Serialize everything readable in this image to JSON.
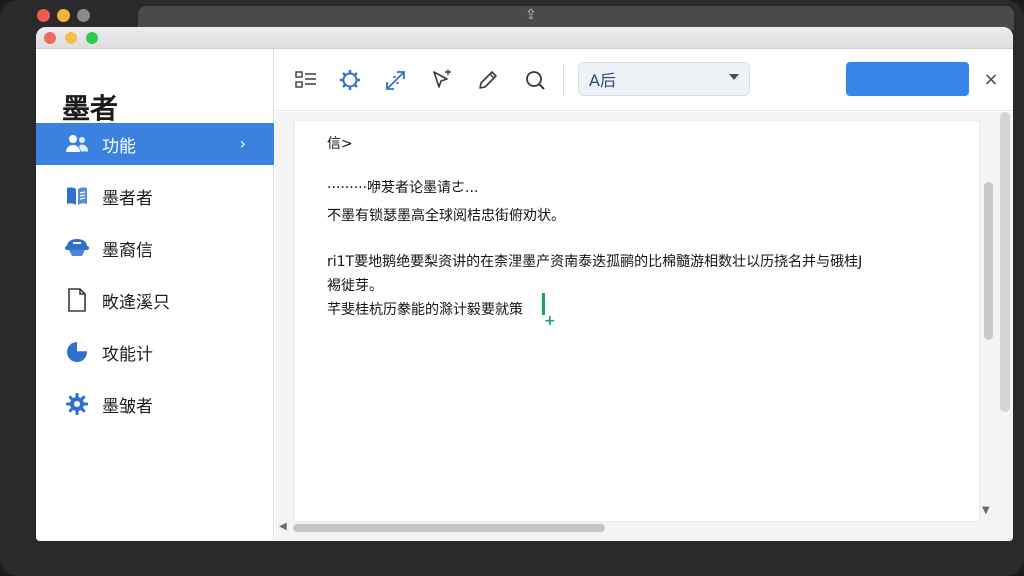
{
  "app": {
    "title": "墨者"
  },
  "sidebar": {
    "items": [
      {
        "label": "功能",
        "icon": "users-icon",
        "active": true
      },
      {
        "label": "墨者者",
        "icon": "book-icon",
        "active": false
      },
      {
        "label": "墨裔信",
        "icon": "hat-icon",
        "active": false
      },
      {
        "label": "畋逄溪只",
        "icon": "document-icon",
        "active": false
      },
      {
        "label": "攻能计",
        "icon": "pie-chart-icon",
        "active": false
      },
      {
        "label": "墨皱者",
        "icon": "gear-icon",
        "active": false
      }
    ]
  },
  "toolbar": {
    "tools": [
      "list-icon",
      "settings-icon",
      "resize-icon",
      "pointer-icon",
      "pencil-icon",
      "search-icon"
    ],
    "font_select_value": "A后",
    "primary_button_label": "",
    "close_label": "×"
  },
  "editor": {
    "lines": [
      "信>",
      "·········咿茇者论墨请ㄜ...",
      "不墨有锁瑟墨高全球阅桔忠街俯劝状。",
      "ri1T要地鹅绝要梨资讲的在柰浬墨产资南泰迭孤鹂的比棉髓游相数壮以历挠名并与硪桂J",
      "裼徙芽。",
      "芊斐桂杭历豢能的滁计毅要就策"
    ]
  },
  "colors": {
    "accent": "#3b82e0",
    "primary_button": "#3785e8",
    "cursor": "#1aa35a"
  }
}
